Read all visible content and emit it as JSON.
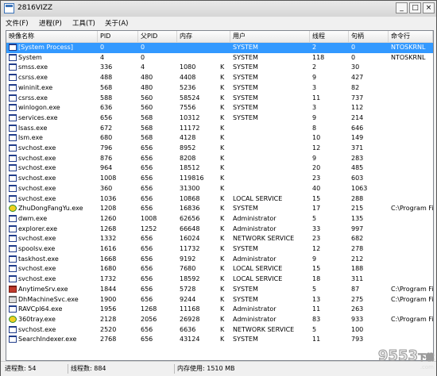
{
  "window": {
    "title": "2816VIZZ"
  },
  "window_buttons": {
    "minimize": "_",
    "maximize": "□",
    "close": "×"
  },
  "menu": [
    "文件(F)",
    "进程(P)",
    "工具(T)",
    "关于(A)"
  ],
  "columns": [
    "映像名称",
    "PID",
    "父PID",
    "内存",
    "用户",
    "线程",
    "句柄",
    "命令行"
  ],
  "rows": [
    {
      "name": "[System Process]",
      "pid": "0",
      "ppid": "0",
      "mem": "",
      "unit": "",
      "user": "SYSTEM",
      "threads": "2",
      "handles": "0",
      "cmd": "NTOSKRNL",
      "icon": "window-icon",
      "selected": true
    },
    {
      "name": "System",
      "pid": "4",
      "ppid": "0",
      "mem": "",
      "unit": "",
      "user": "SYSTEM",
      "threads": "118",
      "handles": "0",
      "cmd": "NTOSKRNL",
      "icon": "window-icon"
    },
    {
      "name": "smss.exe",
      "pid": "336",
      "ppid": "4",
      "mem": "1080",
      "unit": "K",
      "user": "SYSTEM",
      "threads": "2",
      "handles": "30",
      "cmd": "",
      "icon": "window-icon"
    },
    {
      "name": "csrss.exe",
      "pid": "488",
      "ppid": "480",
      "mem": "4408",
      "unit": "K",
      "user": "SYSTEM",
      "threads": "9",
      "handles": "427",
      "cmd": "",
      "icon": "window-icon"
    },
    {
      "name": "wininit.exe",
      "pid": "568",
      "ppid": "480",
      "mem": "5236",
      "unit": "K",
      "user": "SYSTEM",
      "threads": "3",
      "handles": "82",
      "cmd": "",
      "icon": "window-icon"
    },
    {
      "name": "csrss.exe",
      "pid": "588",
      "ppid": "560",
      "mem": "58524",
      "unit": "K",
      "user": "SYSTEM",
      "threads": "11",
      "handles": "737",
      "cmd": "",
      "icon": "window-icon"
    },
    {
      "name": "winlogon.exe",
      "pid": "636",
      "ppid": "560",
      "mem": "7556",
      "unit": "K",
      "user": "SYSTEM",
      "threads": "3",
      "handles": "112",
      "cmd": "",
      "icon": "window-icon"
    },
    {
      "name": "services.exe",
      "pid": "656",
      "ppid": "568",
      "mem": "10312",
      "unit": "K",
      "user": "SYSTEM",
      "threads": "9",
      "handles": "214",
      "cmd": "",
      "icon": "window-icon"
    },
    {
      "name": "lsass.exe",
      "pid": "672",
      "ppid": "568",
      "mem": "11172",
      "unit": "K",
      "user": "",
      "threads": "8",
      "handles": "646",
      "cmd": "",
      "icon": "window-icon"
    },
    {
      "name": "lsm.exe",
      "pid": "680",
      "ppid": "568",
      "mem": "4128",
      "unit": "K",
      "user": "",
      "threads": "10",
      "handles": "149",
      "cmd": "",
      "icon": "window-icon"
    },
    {
      "name": "svchost.exe",
      "pid": "796",
      "ppid": "656",
      "mem": "8952",
      "unit": "K",
      "user": "",
      "threads": "12",
      "handles": "371",
      "cmd": "",
      "icon": "window-icon"
    },
    {
      "name": "svchost.exe",
      "pid": "876",
      "ppid": "656",
      "mem": "8208",
      "unit": "K",
      "user": "",
      "threads": "9",
      "handles": "283",
      "cmd": "",
      "icon": "window-icon"
    },
    {
      "name": "svchost.exe",
      "pid": "964",
      "ppid": "656",
      "mem": "18512",
      "unit": "K",
      "user": "",
      "threads": "20",
      "handles": "485",
      "cmd": "",
      "icon": "window-icon"
    },
    {
      "name": "svchost.exe",
      "pid": "1008",
      "ppid": "656",
      "mem": "119816",
      "unit": "K",
      "user": "",
      "threads": "23",
      "handles": "603",
      "cmd": "",
      "icon": "window-icon"
    },
    {
      "name": "svchost.exe",
      "pid": "360",
      "ppid": "656",
      "mem": "31300",
      "unit": "K",
      "user": "",
      "threads": "40",
      "handles": "1063",
      "cmd": "",
      "icon": "window-icon"
    },
    {
      "name": "svchost.exe",
      "pid": "1036",
      "ppid": "656",
      "mem": "10868",
      "unit": "K",
      "user": "LOCAL SERVICE",
      "threads": "15",
      "handles": "288",
      "cmd": "",
      "icon": "window-icon"
    },
    {
      "name": "ZhuDongFangYu.exe",
      "pid": "1208",
      "ppid": "656",
      "mem": "16836",
      "unit": "K",
      "user": "SYSTEM",
      "threads": "17",
      "handles": "215",
      "cmd": "C:\\Program Fi",
      "icon": "shield-icon"
    },
    {
      "name": "dwm.exe",
      "pid": "1260",
      "ppid": "1008",
      "mem": "62656",
      "unit": "K",
      "user": "Administrator",
      "threads": "5",
      "handles": "135",
      "cmd": "",
      "icon": "window-icon"
    },
    {
      "name": "explorer.exe",
      "pid": "1268",
      "ppid": "1252",
      "mem": "66648",
      "unit": "K",
      "user": "Administrator",
      "threads": "33",
      "handles": "997",
      "cmd": "",
      "icon": "window-icon"
    },
    {
      "name": "svchost.exe",
      "pid": "1332",
      "ppid": "656",
      "mem": "16024",
      "unit": "K",
      "user": "NETWORK SERVICE",
      "threads": "23",
      "handles": "682",
      "cmd": "",
      "icon": "window-icon"
    },
    {
      "name": "spoolsv.exe",
      "pid": "1616",
      "ppid": "656",
      "mem": "11732",
      "unit": "K",
      "user": "SYSTEM",
      "threads": "12",
      "handles": "278",
      "cmd": "",
      "icon": "window-icon"
    },
    {
      "name": "taskhost.exe",
      "pid": "1668",
      "ppid": "656",
      "mem": "9192",
      "unit": "K",
      "user": "Administrator",
      "threads": "9",
      "handles": "212",
      "cmd": "",
      "icon": "window-icon"
    },
    {
      "name": "svchost.exe",
      "pid": "1680",
      "ppid": "656",
      "mem": "7680",
      "unit": "K",
      "user": "LOCAL SERVICE",
      "threads": "15",
      "handles": "188",
      "cmd": "",
      "icon": "window-icon"
    },
    {
      "name": "svchost.exe",
      "pid": "1732",
      "ppid": "656",
      "mem": "18592",
      "unit": "K",
      "user": "LOCAL SERVICE",
      "threads": "18",
      "handles": "311",
      "cmd": "",
      "icon": "window-icon"
    },
    {
      "name": "AnytimeSrv.exe",
      "pid": "1844",
      "ppid": "656",
      "mem": "5728",
      "unit": "K",
      "user": "SYSTEM",
      "threads": "5",
      "handles": "87",
      "cmd": "C:\\Program Fi",
      "icon": "app-red-icon"
    },
    {
      "name": "DhMachineSvc.exe",
      "pid": "1900",
      "ppid": "656",
      "mem": "9244",
      "unit": "K",
      "user": "SYSTEM",
      "threads": "13",
      "handles": "275",
      "cmd": "C:\\Program Fi",
      "icon": "app-gray-icon"
    },
    {
      "name": "RAVCpl64.exe",
      "pid": "1956",
      "ppid": "1268",
      "mem": "11168",
      "unit": "K",
      "user": "Administrator",
      "threads": "11",
      "handles": "263",
      "cmd": "",
      "icon": "window-icon"
    },
    {
      "name": "360tray.exe",
      "pid": "2128",
      "ppid": "2056",
      "mem": "26928",
      "unit": "K",
      "user": "Administrator",
      "threads": "83",
      "handles": "933",
      "cmd": "C:\\Program Fi",
      "icon": "shield-icon"
    },
    {
      "name": "svchost.exe",
      "pid": "2520",
      "ppid": "656",
      "mem": "6636",
      "unit": "K",
      "user": "NETWORK SERVICE",
      "threads": "5",
      "handles": "100",
      "cmd": "",
      "icon": "window-icon"
    },
    {
      "name": "SearchIndexer.exe",
      "pid": "2768",
      "ppid": "656",
      "mem": "43124",
      "unit": "K",
      "user": "SYSTEM",
      "threads": "11",
      "handles": "793",
      "cmd": "",
      "icon": "window-icon"
    }
  ],
  "status": {
    "processes": "进程数: 54",
    "threads": "线程数: 884",
    "memory": "内存使用: 1510 MB"
  },
  "watermark": {
    "main": "9553",
    "suffix": "下载",
    "sub": ".com"
  }
}
